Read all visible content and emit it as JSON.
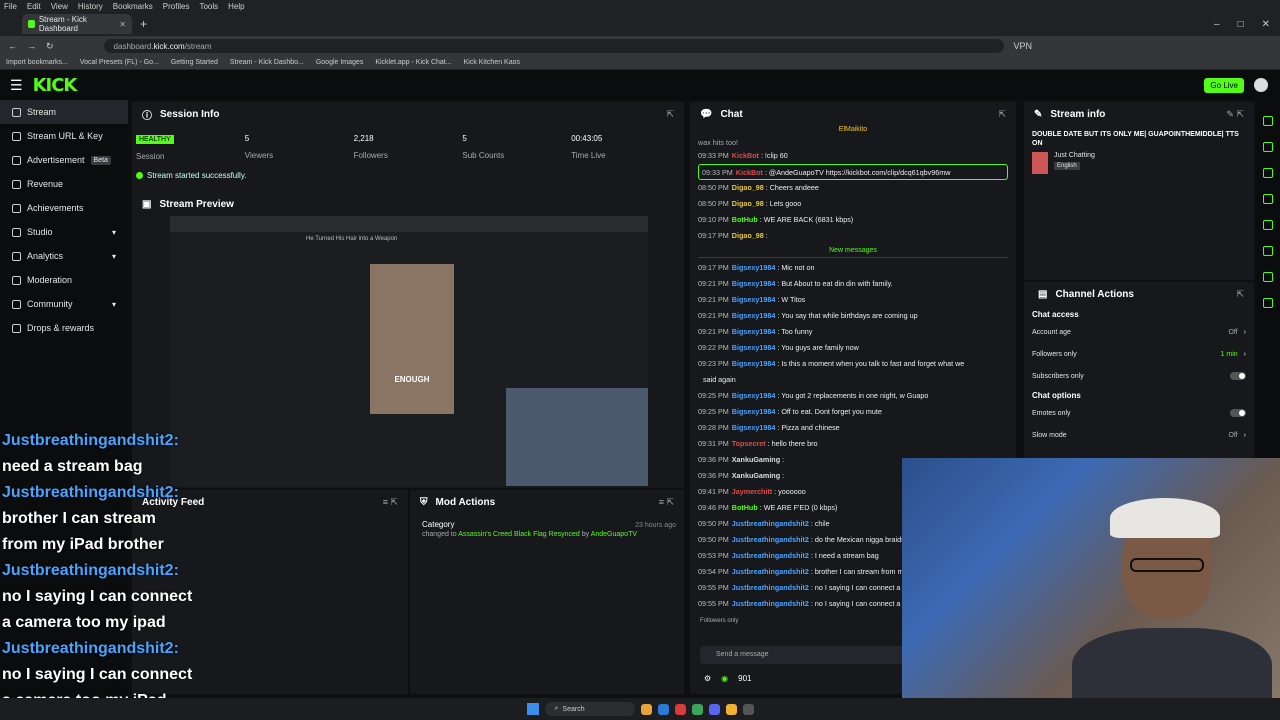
{
  "browser": {
    "menu": [
      "File",
      "Edit",
      "View",
      "History",
      "Bookmarks",
      "Profiles",
      "Tools",
      "Help"
    ],
    "tab_title": "Stream - Kick Dashboard",
    "url_host": "dashboard.",
    "url_domain": "kick.com",
    "url_path": "/stream",
    "vpn": "VPN",
    "bookmarks": [
      "Import bookmarks...",
      "Vocal Presets (FL) - Go...",
      "Getting Started",
      "Stream - Kick Dashbo...",
      "Google Images",
      "Kicklet.app - Kick Chat...",
      "Kick Kitchen Kaos"
    ]
  },
  "header": {
    "logo": "KICK",
    "go_live": "Go Live"
  },
  "sidebar": {
    "items": [
      {
        "label": "Stream",
        "active": true
      },
      {
        "label": "Stream URL & Key"
      },
      {
        "label": "Advertisement",
        "badge": "Beta"
      },
      {
        "label": "Revenue"
      },
      {
        "label": "Achievements"
      },
      {
        "label": "Studio",
        "chevron": true
      },
      {
        "label": "Analytics",
        "chevron": true
      },
      {
        "label": "Moderation"
      },
      {
        "label": "Community",
        "chevron": true
      },
      {
        "label": "Drops & rewards"
      }
    ]
  },
  "session": {
    "title": "Session Info",
    "health": "HEALTHY",
    "session_label": "Session",
    "viewers": "5",
    "viewers_label": "Viewers",
    "followers": "2,218",
    "followers_label": "Followers",
    "subs": "5",
    "subs_label": "Sub Counts",
    "time": "00:43:05",
    "time_label": "Time Live",
    "status": "Stream started successfully."
  },
  "preview": {
    "title": "Stream Preview",
    "video_caption": "ENOUGH",
    "video_title": "He Turned His Hair into a Weapon",
    "overlay_lines": [
      "Justbreathingandshit2:",
      "need a stream bag",
      "Justbreathingandshit2:",
      "brother I can stream",
      "from my iPad brother",
      "Justbreathingandshit2:",
      "no I saying I can connect",
      "a camera too my ipad",
      "Justbreathingandshit2:",
      "no I saying I can connect",
      "a camera too my iPad"
    ]
  },
  "activity": {
    "title": "Activity Feed"
  },
  "mod_actions": {
    "title": "Mod Actions",
    "item_title": "Category",
    "item_prefix": "changed to",
    "item_value": "Assassin's Creed Black Flag Resynced",
    "item_by_prefix": "by",
    "item_by": "AndeGuapoTV",
    "item_time": "23 hours ago"
  },
  "chat": {
    "title": "Chat",
    "pinned": "ElMaikito",
    "top_snip": "wax hits too!",
    "new_messages": "New messages",
    "messages": [
      {
        "t": "09:33 PM",
        "u": "KickBot",
        "c": "#e04a4a",
        "m": ": !clip 60"
      },
      {
        "t": "09:33 PM",
        "u": "KickBot",
        "c": "#e04a4a",
        "m": ": @AndeGuapoTV https://kickbot.com/clip/dcq61qbv96mw",
        "hl": true
      },
      {
        "t": "08:50 PM",
        "u": "Digao_98",
        "c": "#e6c74a",
        "m": ": Cheers andeee"
      },
      {
        "t": "08:50 PM",
        "u": "Digao_98",
        "c": "#e6c74a",
        "m": ": Lets gooo"
      },
      {
        "t": "09:10 PM",
        "u": "BotHub",
        "c": "#53fc18",
        "m": ": WE ARE BACK (6831 kbps)"
      },
      {
        "t": "09:17 PM",
        "u": "Digao_98",
        "c": "#e6c74a",
        "m": ":"
      },
      {
        "new": true
      },
      {
        "t": "09:17 PM",
        "u": "Bigsexy1984",
        "c": "#4aa3ff",
        "m": ": Mic not on"
      },
      {
        "t": "09:21 PM",
        "u": "Bigsexy1984",
        "c": "#4aa3ff",
        "m": ": But About to eat din din with family."
      },
      {
        "t": "09:21 PM",
        "u": "Bigsexy1984",
        "c": "#4aa3ff",
        "m": ": W Titos"
      },
      {
        "t": "09:21 PM",
        "u": "Bigsexy1984",
        "c": "#4aa3ff",
        "m": ": You say that while birthdays are coming up"
      },
      {
        "t": "09:21 PM",
        "u": "Bigsexy1984",
        "c": "#4aa3ff",
        "m": ": Too funny"
      },
      {
        "t": "09:22 PM",
        "u": "Bigsexy1984",
        "c": "#4aa3ff",
        "m": ": You guys are family now"
      },
      {
        "t": "09:23 PM",
        "u": "Bigsexy1984",
        "c": "#4aa3ff",
        "m": ": Is this a moment when you talk to fast and forget what we"
      },
      {
        "t": "",
        "u": "",
        "c": "#fff",
        "m": "said again"
      },
      {
        "t": "09:25 PM",
        "u": "Bigsexy1984",
        "c": "#4aa3ff",
        "m": ": You got 2 replacements in one night, w Guapo"
      },
      {
        "t": "09:25 PM",
        "u": "Bigsexy1984",
        "c": "#4aa3ff",
        "m": ": Off to eat. Dont forget you mute"
      },
      {
        "t": "09:28 PM",
        "u": "Bigsexy1984",
        "c": "#4aa3ff",
        "m": ": Pizza and chinese"
      },
      {
        "t": "09:31 PM",
        "u": "Topsecret",
        "c": "#e04a4a",
        "m": ": hello there bro"
      },
      {
        "t": "09:36 PM",
        "u": "XankuGaming",
        "c": "#ddd",
        "m": ":"
      },
      {
        "t": "09:36 PM",
        "u": "XankuGaming",
        "c": "#ddd",
        "m": ":"
      },
      {
        "t": "09:41 PM",
        "u": "Jaymerchitt",
        "c": "#e04a4a",
        "m": ": yoooooo"
      },
      {
        "t": "09:46 PM",
        "u": "BotHub",
        "c": "#53fc18",
        "m": ": WE ARE F'ED (0 kbps)"
      },
      {
        "t": "09:50 PM",
        "u": "Justbreathingandshit2",
        "c": "#4aa3ff",
        "m": ": chile"
      },
      {
        "t": "09:50 PM",
        "u": "Justbreathingandshit2",
        "c": "#4aa3ff",
        "m": ": do the Mexican nigga braids"
      },
      {
        "t": "09:53 PM",
        "u": "Justbreathingandshit2",
        "c": "#4aa3ff",
        "m": ": I need a stream bag"
      },
      {
        "t": "09:54 PM",
        "u": "Justbreathingandshit2",
        "c": "#4aa3ff",
        "m": ": brother I can stream from m"
      },
      {
        "t": "09:55 PM",
        "u": "Justbreathingandshit2",
        "c": "#4aa3ff",
        "m": ": no I saying I can connect a"
      },
      {
        "t": "09:55 PM",
        "u": "Justbreathingandshit2",
        "c": "#4aa3ff",
        "m": ": no I saying I can connect a"
      }
    ],
    "followers_only": "Followers only",
    "input_placeholder": "Send a message",
    "points": "901"
  },
  "stream_info": {
    "title": "Stream info",
    "stream_title": "DOUBLE DATE BUT ITS ONLY ME| GUAPOINTHEMIDDLE| TTS ON",
    "category": "Just Chatting",
    "language": "English"
  },
  "channel_actions": {
    "title": "Channel Actions",
    "chat_access": "Chat access",
    "account_age": "Account age",
    "account_age_val": "Off",
    "followers_only": "Followers only",
    "followers_only_val": "1 min",
    "subscribers_only": "Subscribers only",
    "chat_options": "Chat options",
    "emotes_only": "Emotes only",
    "slow_mode": "Slow mode",
    "slow_mode_val": "Off"
  },
  "taskbar": {
    "search": "Search"
  },
  "colors": {
    "accent": "#53fc18",
    "bg": "#0e0f11",
    "panel": "#17181c"
  }
}
